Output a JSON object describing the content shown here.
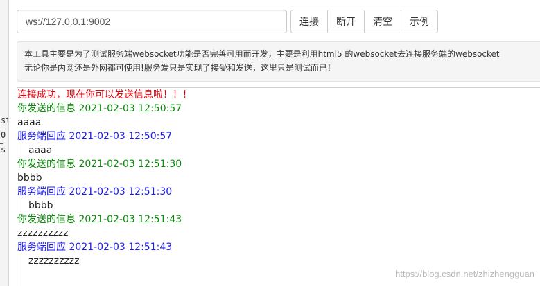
{
  "behind_window": {
    "fragments": [
      "st",
      "0",
      "s"
    ]
  },
  "toolbar": {
    "url_value": "ws://127.0.0.1:9002",
    "buttons": {
      "connect": "连接",
      "disconnect": "断开",
      "clear": "清空",
      "example": "示例"
    }
  },
  "info": {
    "line1": "本工具主要是为了测试服务端websocket功能是否完善可用而开发，主要是利用html5 的websocket去连接服务端的websocket",
    "line2": "无论你是内网还是外网都可使用!服务端只是实现了接受和发送，这里只是测试而已！"
  },
  "log": {
    "status": "连接成功，现在你可以发送信息啦！！！",
    "entries": [
      {
        "sent_header": "你发送的信息 2021-02-03 12:50:57",
        "sent_body": "aaaa",
        "reply_header": "服务端回应 2021-02-03 12:50:57",
        "reply_body": "aaaa"
      },
      {
        "sent_header": "你发送的信息 2021-02-03 12:51:30",
        "sent_body": "bbbb",
        "reply_header": "服务端回应 2021-02-03 12:51:30",
        "reply_body": "bbbb"
      },
      {
        "sent_header": "你发送的信息 2021-02-03 12:51:43",
        "sent_body": "zzzzzzzzzz",
        "reply_header": "服务端回应 2021-02-03 12:51:43",
        "reply_body": "zzzzzzzzzz"
      }
    ]
  },
  "watermark": "https://blog.csdn.net/zhizhengguan",
  "colors": {
    "status": "#e8000b",
    "sent": "#0a8a0a",
    "reply": "#1a1aee",
    "body": "#222222"
  }
}
